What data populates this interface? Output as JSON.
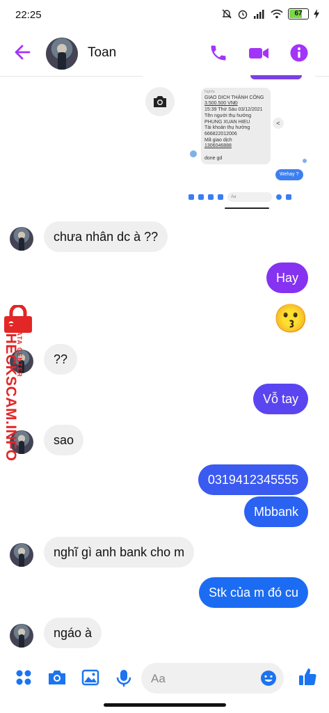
{
  "status_bar": {
    "time": "22:25",
    "battery": "67"
  },
  "header": {
    "contact_name": "Toan"
  },
  "colors": {
    "accent": "#a334fa",
    "outgoing_top": "#8533f0",
    "outgoing_bottom": "#1b6cf2",
    "watermark": "#e32626"
  },
  "embedded_screenshot": {
    "receipt": {
      "title_small": "Nghĩa",
      "lines": [
        "GIAO DICH THÀNH CÔNG",
        "3.500.500 VNĐ",
        "15:39 Thứ Sáu 03/12/2021",
        "Tên người thụ hưởng",
        "PHUNG XUAN HIEU",
        "Tài khoản thụ hưởng",
        "666822012006",
        "Mã giao dịch",
        "1306046888",
        "",
        "done gd"
      ]
    },
    "bubble": "Wehay ?",
    "input_placeholder": "Aa"
  },
  "messages": [
    {
      "direction": "in",
      "text": "chưa nhân dc à ??"
    },
    {
      "direction": "out",
      "text": "Hay"
    },
    {
      "direction": "out",
      "emoji": "😗"
    },
    {
      "direction": "in",
      "text": "??"
    },
    {
      "direction": "out",
      "text": "Vỗ tay"
    },
    {
      "direction": "in",
      "text": "sao"
    },
    {
      "direction": "out",
      "text": "0319412345555"
    },
    {
      "direction": "out",
      "text": "Mbbank"
    },
    {
      "direction": "in",
      "text": "nghĩ gì anh bank cho m"
    },
    {
      "direction": "out",
      "text": "Stk của m đó cu"
    },
    {
      "direction": "in",
      "text": "ngáo à"
    }
  ],
  "watermark": {
    "brand": "CHECKSCAM.INFO",
    "tagline": "DATA CENTER"
  },
  "composer": {
    "placeholder": "Aa"
  },
  "icons": [
    "back-arrow-icon",
    "phone-icon",
    "video-icon",
    "info-icon",
    "camera-icon",
    "grid-icon",
    "gallery-icon",
    "mic-icon",
    "emoji-icon",
    "thumbs-up-icon"
  ]
}
